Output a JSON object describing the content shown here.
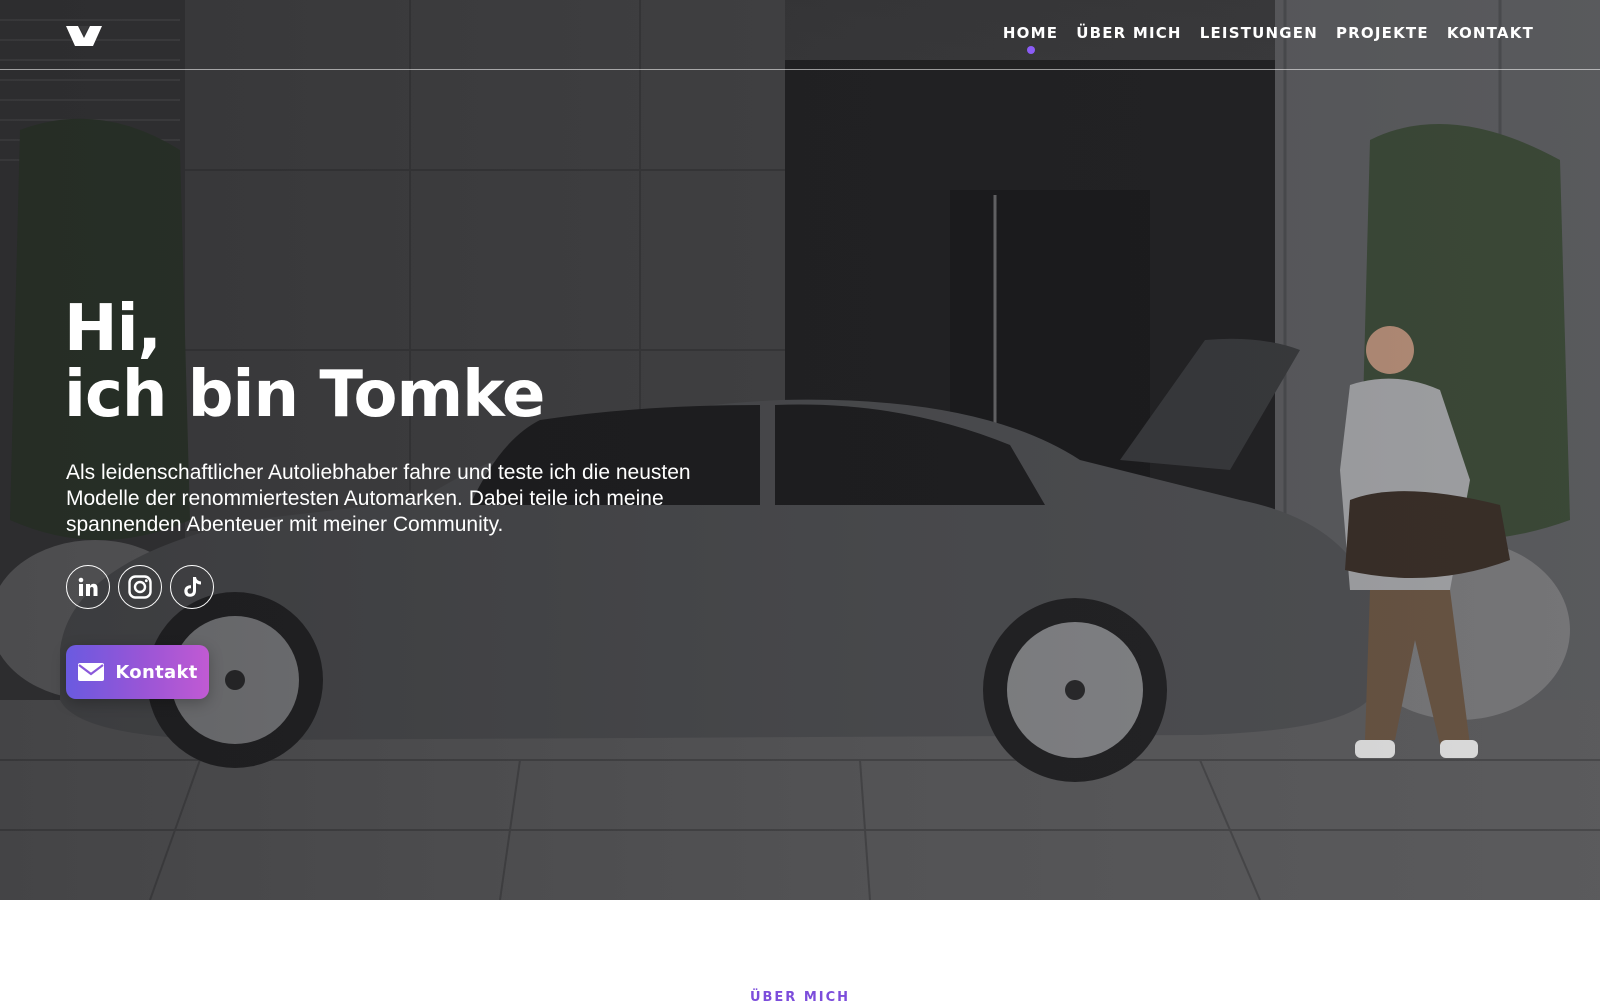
{
  "nav": {
    "items": [
      {
        "label": "HOME",
        "active": true
      },
      {
        "label": "ÜBER MICH",
        "active": false
      },
      {
        "label": "LEISTUNGEN",
        "active": false
      },
      {
        "label": "PROJEKTE",
        "active": false
      },
      {
        "label": "KONTAKT",
        "active": false
      }
    ],
    "active_indicator_color": "#8b5cf6"
  },
  "hero": {
    "greeting": "Hi,",
    "headline_prefix": "ich bin ",
    "headline_name": "Tomke",
    "intro": "Als leidenschaftlicher Autoliebhaber fahre und teste ich die neusten Modelle der renommiertesten Automarken. Dabei teile ich meine spannenden Abenteuer mit meiner Community.",
    "socials": [
      {
        "icon": "linkedin-icon"
      },
      {
        "icon": "instagram-icon"
      },
      {
        "icon": "tiktok-icon"
      }
    ],
    "cta_label": "Kontakt",
    "cta_icon": "mail-icon",
    "cta_gradient": [
      "#6a5ae0",
      "#c15ad3"
    ]
  },
  "about": {
    "section_label": "ÜBER MICH"
  }
}
